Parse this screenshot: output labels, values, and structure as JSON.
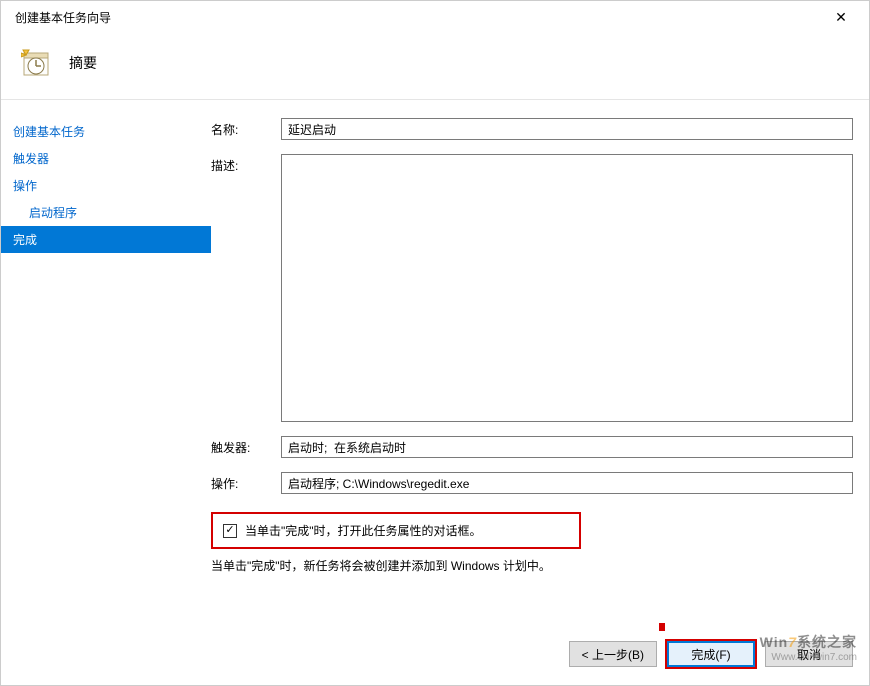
{
  "window": {
    "title": "创建基本任务向导",
    "close": "✕"
  },
  "header": {
    "title": "摘要"
  },
  "sidebar": {
    "items": [
      {
        "label": "创建基本任务"
      },
      {
        "label": "触发器"
      },
      {
        "label": "操作"
      },
      {
        "label": "启动程序"
      },
      {
        "label": "完成"
      }
    ]
  },
  "form": {
    "name_label": "名称:",
    "name_value": "延迟启动",
    "desc_label": "描述:",
    "desc_value": "",
    "trigger_label": "触发器:",
    "trigger_value": "启动时;  在系统启动时",
    "action_label": "操作:",
    "action_value": "启动程序; C:\\Windows\\regedit.exe"
  },
  "checkbox": {
    "checked": true,
    "mark": "✓",
    "label": "当单击\"完成\"时，打开此任务属性的对话框。"
  },
  "note": "当单击\"完成\"时，新任务将会被创建并添加到 Windows 计划中。",
  "buttons": {
    "back": "< 上一步(B)",
    "finish": "完成(F)",
    "cancel": "取消"
  },
  "watermark": {
    "line1a": "Win",
    "line1b": "7",
    "line1c": "系统之家",
    "line2": "Www.Winwin7.com"
  }
}
